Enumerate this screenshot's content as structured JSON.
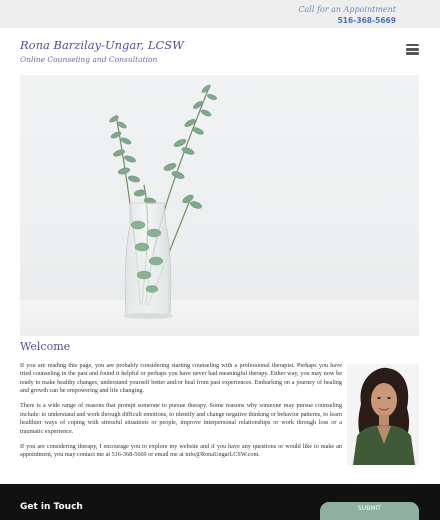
{
  "topbar": {
    "call_label": "Call for an Appointment",
    "phone": "516-368-5669"
  },
  "header": {
    "title": "Rona Barzilay-Ungar, LCSW",
    "tagline": "Online Counseling and Consultation",
    "menu_icon": "hamburger-menu-icon"
  },
  "hero": {
    "image_subject": "eucalyptus-sprigs-in-glass-vase"
  },
  "main": {
    "heading": "Welcome",
    "paragraphs": [
      "If you are reading this page, you are probably considering starting counseling with a professional therapist. Perhaps you have tried counseling in the past and found it helpful or perhaps you have never had meaningful therapy. Either way, you may now be ready to make healthy changes, understand yourself better and/or heal from past experiences. Embarking on a journey of healing and growth can be empowering and life changing.",
      "There is a wide range of reasons that prompt someone to pursue therapy. Some reasons why someone may pursue counseling include: to understand and work through difficult emotions, to identify and change negative thinking or behavior patterns, to learn healthier ways of coping with stressful situations or people, improve interpersonal relationships or work through loss or a traumatic experience.",
      "If you are considering therapy, I encourage you to explore my website and if you have any questions or would like to make an appointment, you may contact me at 516-368-5669 or email me at info@RonaUngarLCSW.com."
    ]
  },
  "footer": {
    "title": "Get in Touch",
    "button_label": "SUBMIT"
  },
  "colors": {
    "accent_purple": "#5a4a9a",
    "phone_blue": "#4b74b3",
    "footer_bg": "#111111"
  }
}
